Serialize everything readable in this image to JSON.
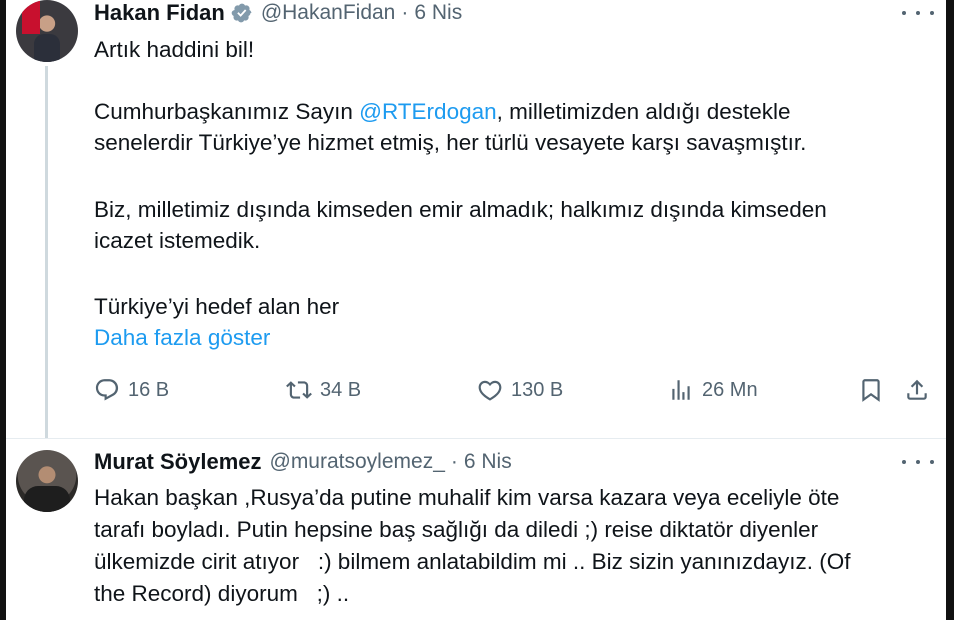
{
  "tweet1": {
    "name": "Hakan Fidan",
    "handle": "@HakanFidan",
    "dot": "·",
    "date": "6 Nis",
    "line1": "Artık haddini bil!",
    "p2_pre": "Cumhurbaşkanımız Sayın ",
    "p2_mention": "@RTErdogan",
    "p2_post_line1": ", milletimizden aldığı destekle",
    "p2_line2": "senelerdir Türkiye’ye hizmet etmiş, her türlü vesayete karşı savaşmıştır.",
    "p3_line1": "Biz, milletimiz dışında kimseden emir almadık; halkımız dışında kimseden",
    "p3_line2": "icazet istemedik.",
    "p4": "Türkiye’yi hedef alan her",
    "show_more": "Daha fazla göster",
    "replies": "16 B",
    "reposts": "34 B",
    "likes": "130 B",
    "views": "26 Mn"
  },
  "tweet2": {
    "name": "Murat Söylemez",
    "handle": "@muratsoylemez_",
    "dot": "·",
    "date": "6 Nis",
    "line1": "Hakan başkan ,Rusya’da putine muhalif kim varsa kazara veya eceliyle öte",
    "line2": "tarafı boyladı. Putin hepsine baş sağlığı da diledi ;) reise diktatör diyenler",
    "line3": "ülkemizde cirit atıyor   :) bilmem anlatabildim mi .. Biz sizin yanınızdayız. (Of",
    "line4": "the Record) diyorum   ;) .."
  },
  "colors": {
    "link": "#1d9bf0",
    "muted": "#536471",
    "text": "#0f1419",
    "verified": "#829aab"
  },
  "icons": [
    "verified-badge-icon",
    "more-options-icon",
    "reply-icon",
    "repost-icon",
    "like-icon",
    "views-icon",
    "bookmark-icon",
    "share-icon"
  ]
}
